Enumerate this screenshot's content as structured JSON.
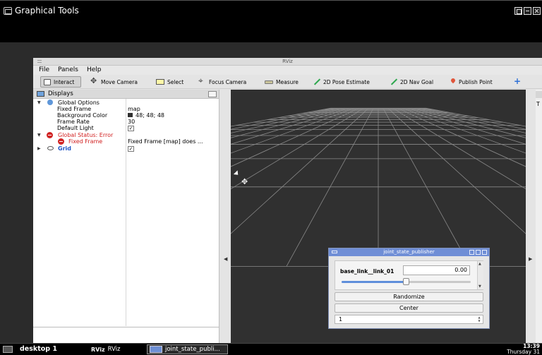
{
  "host": {
    "title": "Graphical Tools"
  },
  "rviz": {
    "title": "RViz",
    "menu": [
      "File",
      "Panels",
      "Help"
    ],
    "tools": [
      {
        "label": "Interact",
        "icon": "interact-icon"
      },
      {
        "label": "Move Camera",
        "icon": "move-camera-icon"
      },
      {
        "label": "Select",
        "icon": "select-icon"
      },
      {
        "label": "Focus Camera",
        "icon": "focus-camera-icon"
      },
      {
        "label": "Measure",
        "icon": "measure-icon"
      },
      {
        "label": "2D Pose Estimate",
        "icon": "pose-estimate-icon"
      },
      {
        "label": "2D Nav Goal",
        "icon": "nav-goal-icon"
      },
      {
        "label": "Publish Point",
        "icon": "publish-point-icon"
      }
    ],
    "displays": {
      "title": "Displays",
      "global_options": "Global Options",
      "fixed_frame_label": "Fixed Frame",
      "fixed_frame_value": "map",
      "background_color_label": "Background Color",
      "background_color_value": "48; 48; 48",
      "frame_rate_label": "Frame Rate",
      "frame_rate_value": "30",
      "default_light_label": "Default Light",
      "global_status": "Global Status: Error",
      "status_fixed_frame": "Fixed Frame",
      "status_fixed_frame_value": "Fixed Frame [map] does ...",
      "grid": "Grid",
      "check_mark": "✓"
    },
    "right_panel_letter": "T"
  },
  "jsp": {
    "title": "joint_state_publisher",
    "joint_name": "base_link__link_01",
    "joint_value": "0.00",
    "slider_fraction": 0.5,
    "randomize": "Randomize",
    "center": "Center",
    "spin_value": "1"
  },
  "taskbar": {
    "desktop": "desktop 1",
    "rviz_logo": "RViz",
    "rviz_task": "RViz",
    "jsp_task": "joint_state_publi...",
    "time": "13:39",
    "day": "Thursday 31"
  },
  "colors": {
    "error": "#d11f1f",
    "grid_link": "#1f57c7",
    "view_background": "#303030",
    "grid_line": "#8a8a8a"
  }
}
